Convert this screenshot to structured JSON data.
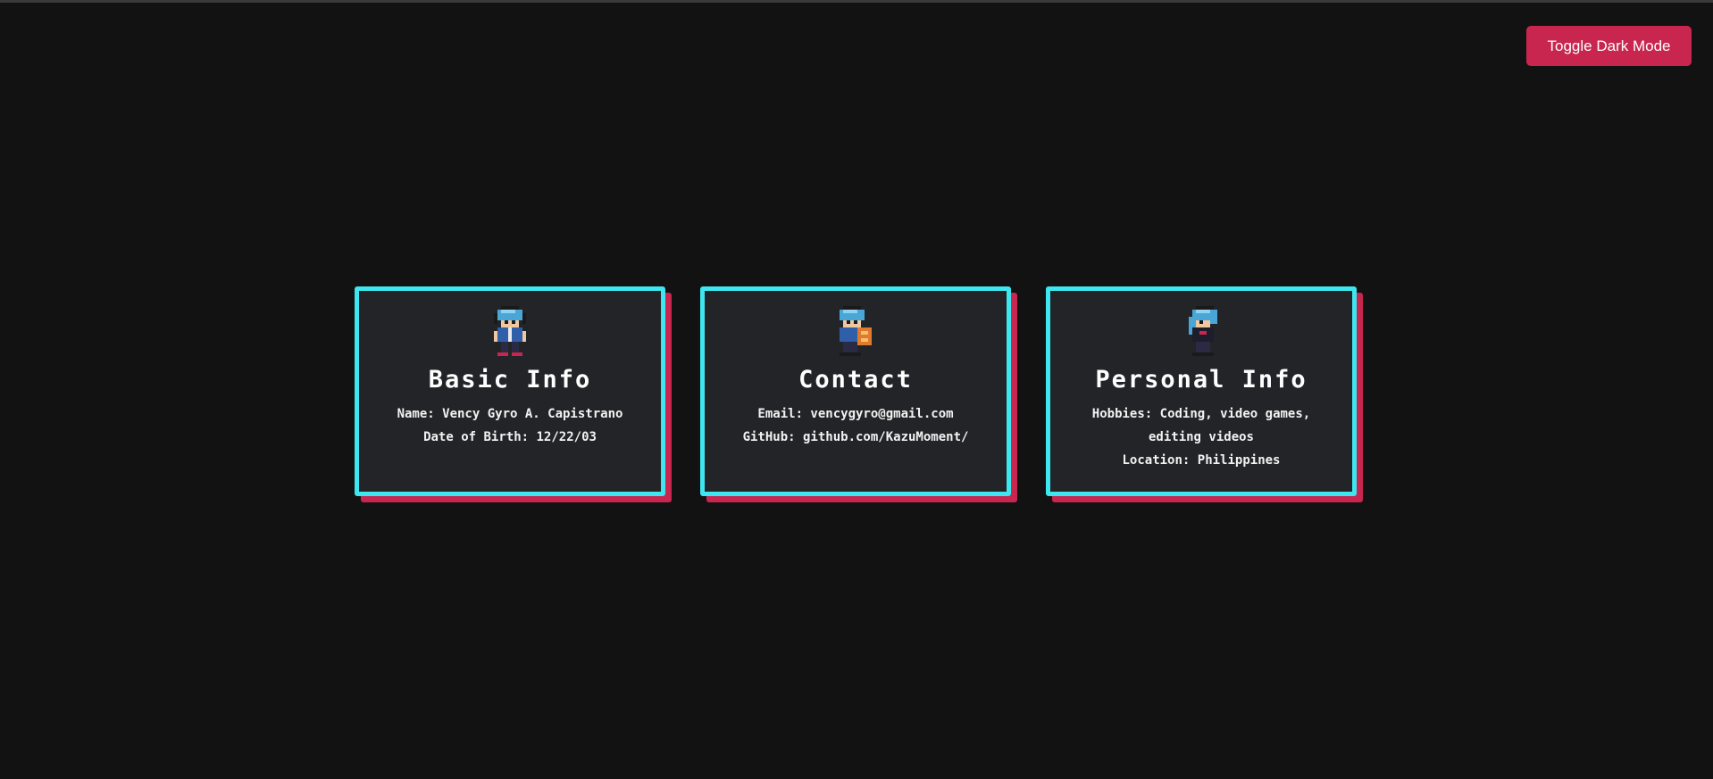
{
  "header": {
    "toggle_label": "Toggle Dark Mode"
  },
  "colors": {
    "background": "#121212",
    "card_background": "#232427",
    "card_border": "#3ee6ef",
    "card_shadow": "#c8264f",
    "button": "#c8264f"
  },
  "cards": [
    {
      "sprite": "pixel-character-icon",
      "title": "Basic Info",
      "lines": [
        "Name: Vency Gyro A. Capistrano",
        "Date of Birth: 12/22/03"
      ]
    },
    {
      "sprite": "pixel-character-shield-icon",
      "title": "Contact",
      "lines": [
        "Email: vencygyro@gmail.com",
        "GitHub: github.com/KazuMoment/"
      ]
    },
    {
      "sprite": "pixel-character-icon",
      "title": "Personal Info",
      "lines": [
        "Hobbies: Coding, video games, editing videos",
        "Location: Philippines"
      ]
    }
  ]
}
